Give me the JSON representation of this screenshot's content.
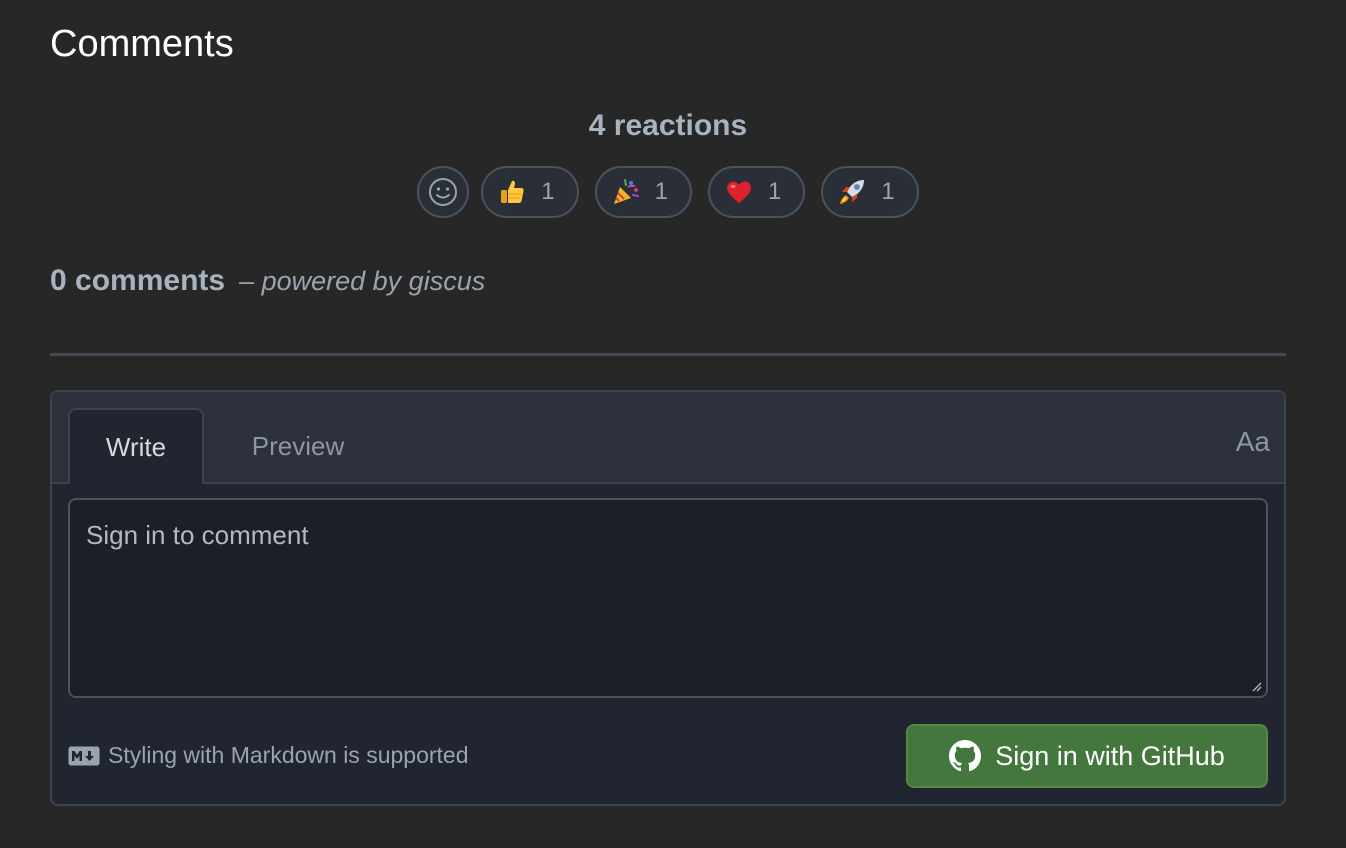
{
  "header": {
    "title": "Comments"
  },
  "reactions": {
    "summary": "4 reactions",
    "add_icon": "smiley-icon",
    "items": [
      {
        "emoji": "thumbs-up",
        "count": "1"
      },
      {
        "emoji": "party-popper",
        "count": "1"
      },
      {
        "emoji": "heart",
        "count": "1"
      },
      {
        "emoji": "rocket",
        "count": "1"
      }
    ]
  },
  "comments": {
    "count_label": "0 comments",
    "powered_by": "– powered by giscus"
  },
  "editor": {
    "tabs": [
      {
        "label": "Write",
        "active": true
      },
      {
        "label": "Preview",
        "active": false
      }
    ],
    "font_toggle": "Aa",
    "placeholder": "Sign in to comment",
    "markdown_hint": "Styling with Markdown is supported",
    "signin_label": "Sign in with GitHub"
  },
  "colors": {
    "background": "#272727",
    "signin_button": "#43773d"
  }
}
